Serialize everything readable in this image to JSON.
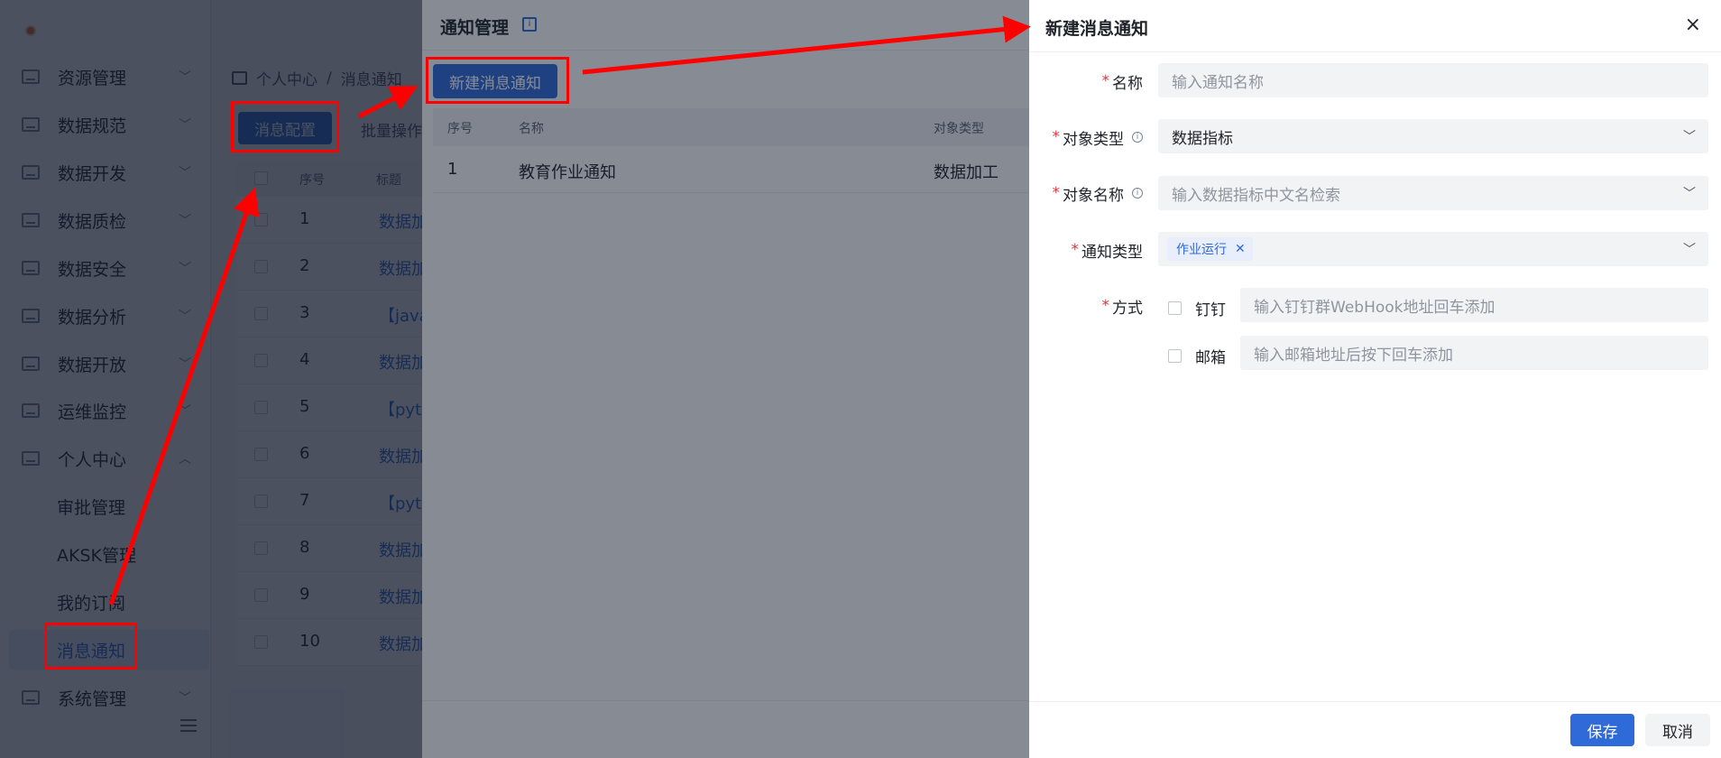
{
  "sidebar": {
    "items": [
      {
        "label": "资源管理"
      },
      {
        "label": "数据规范"
      },
      {
        "label": "数据开发"
      },
      {
        "label": "数据质检"
      },
      {
        "label": "数据安全"
      },
      {
        "label": "数据分析"
      },
      {
        "label": "数据开放"
      },
      {
        "label": "运维监控"
      },
      {
        "label": "个人中心"
      },
      {
        "label": "系统管理"
      }
    ],
    "sub_items": [
      {
        "label": "审批管理"
      },
      {
        "label": "AKSK管理"
      },
      {
        "label": "我的订阅"
      },
      {
        "label": "消息通知"
      }
    ]
  },
  "breadcrumb": {
    "root": "个人中心",
    "separator": "/",
    "current": "消息通知"
  },
  "main": {
    "msg_config_button": "消息配置",
    "batch_op": "批量操作",
    "table_headers": [
      "序号",
      "标题"
    ],
    "rows": [
      {
        "num": "1",
        "title": "数据加"
      },
      {
        "num": "2",
        "title": "数据加"
      },
      {
        "num": "3",
        "title": "【java"
      },
      {
        "num": "4",
        "title": "数据加"
      },
      {
        "num": "5",
        "title": "【pyth"
      },
      {
        "num": "6",
        "title": "数据加"
      },
      {
        "num": "7",
        "title": "【pyth"
      },
      {
        "num": "8",
        "title": "数据加"
      },
      {
        "num": "9",
        "title": "数据加"
      },
      {
        "num": "10",
        "title": "数据加"
      }
    ]
  },
  "notify_drawer": {
    "title": "通知管理",
    "help_icon": "book-icon",
    "new_button": "新建消息通知",
    "table_headers": [
      "序号",
      "名称",
      "对象类型"
    ],
    "row": {
      "num": "1",
      "name": "教育作业通知",
      "type": "数据加工"
    }
  },
  "create_drawer": {
    "title": "新建消息通知",
    "close_icon": "×",
    "fields": {
      "name": {
        "label": "名称",
        "placeholder": "输入通知名称"
      },
      "object_type": {
        "label": "对象类型",
        "value": "数据指标"
      },
      "object_name": {
        "label": "对象名称",
        "placeholder": "输入数据指标中文名检索"
      },
      "notify_type": {
        "label": "通知类型",
        "tag": "作业运行"
      },
      "method": {
        "label": "方式",
        "dingtalk": {
          "label": "钉钉",
          "placeholder": "输入钉钉群WebHook地址回车添加"
        },
        "email": {
          "label": "邮箱",
          "placeholder": "输入邮箱地址后按下回车添加"
        }
      }
    },
    "save_button": "保存",
    "cancel_button": "取消"
  },
  "colors": {
    "primary": "#2f6ad9",
    "required": "#e0343a",
    "annotation": "#ff0000"
  }
}
